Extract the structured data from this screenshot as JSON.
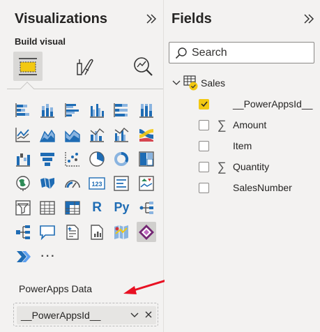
{
  "visualizations": {
    "title": "Visualizations",
    "build_visual_label": "Build visual",
    "section_label": "PowerApps Data",
    "field_well": {
      "value": "__PowerAppsId__"
    },
    "grid": [
      [
        "stacked-bar-chart-icon",
        "stacked-column-chart-icon",
        "clustered-bar-chart-icon",
        "clustered-column-chart-icon",
        "100-stacked-bar-chart-icon",
        "100-stacked-column-chart-icon"
      ],
      [
        "line-chart-icon",
        "area-chart-icon",
        "stacked-area-chart-icon",
        "line-and-column-chart-icon",
        "line-and-clustered-column-chart-icon",
        "ribbon-chart-icon"
      ],
      [
        "waterfall-chart-icon",
        "funnel-chart-icon",
        "scatter-chart-icon",
        "pie-chart-icon",
        "donut-chart-icon",
        "treemap-icon"
      ],
      [
        "map-icon",
        "filled-map-icon",
        "gauge-icon",
        "card-icon",
        "multi-row-card-icon",
        "kpi-icon"
      ],
      [
        "slicer-icon",
        "table-icon",
        "matrix-icon",
        "r-script-visual-icon",
        "python-visual-icon",
        "key-influencers-icon"
      ],
      [
        "decomposition-tree-icon",
        "qa-icon",
        "smart-narrative-icon",
        "paginated-report-icon",
        "azure-map-icon",
        "power-apps-icon"
      ],
      [
        "power-automate-icon",
        "more-visuals-icon"
      ]
    ],
    "text_glyphs": {
      "r": "R",
      "py": "Py",
      "more": "···"
    }
  },
  "fields": {
    "title": "Fields",
    "search_placeholder": "Search",
    "table": {
      "name": "Sales"
    },
    "items": [
      {
        "name": "__PowerAppsId__",
        "checked": true,
        "sigma": false
      },
      {
        "name": "Amount",
        "checked": false,
        "sigma": true
      },
      {
        "name": "Item",
        "checked": false,
        "sigma": false
      },
      {
        "name": "Quantity",
        "checked": false,
        "sigma": true
      },
      {
        "name": "SalesNumber",
        "checked": false,
        "sigma": false
      }
    ]
  },
  "colors": {
    "accent_yellow": "#f2c811",
    "icon_blue": "#1f6cb4",
    "power_apps_purple": "#742774",
    "arrow_red": "#e81123",
    "pane_bg": "#f3f2f1"
  }
}
